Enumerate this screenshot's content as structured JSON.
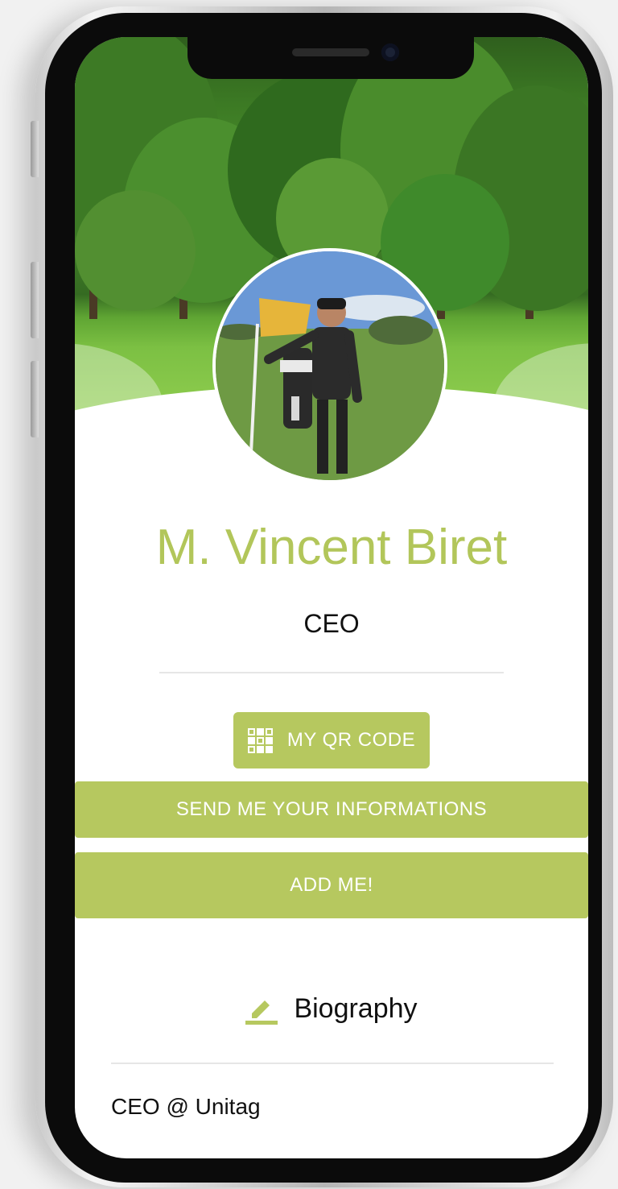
{
  "profile": {
    "name": "M. Vincent Biret",
    "title": "CEO"
  },
  "actions": {
    "qr_label": "MY QR CODE",
    "send_label": "SEND ME YOUR INFORMATIONS",
    "add_label": "ADD ME!"
  },
  "biography": {
    "heading": "Biography",
    "text": "CEO @ Unitag"
  },
  "colors": {
    "accent": "#b6c85f",
    "name_text": "#b2c65a",
    "body_text": "#111111"
  },
  "icons": {
    "qr": "qr-code-icon",
    "biography": "pencil-edit-icon"
  }
}
